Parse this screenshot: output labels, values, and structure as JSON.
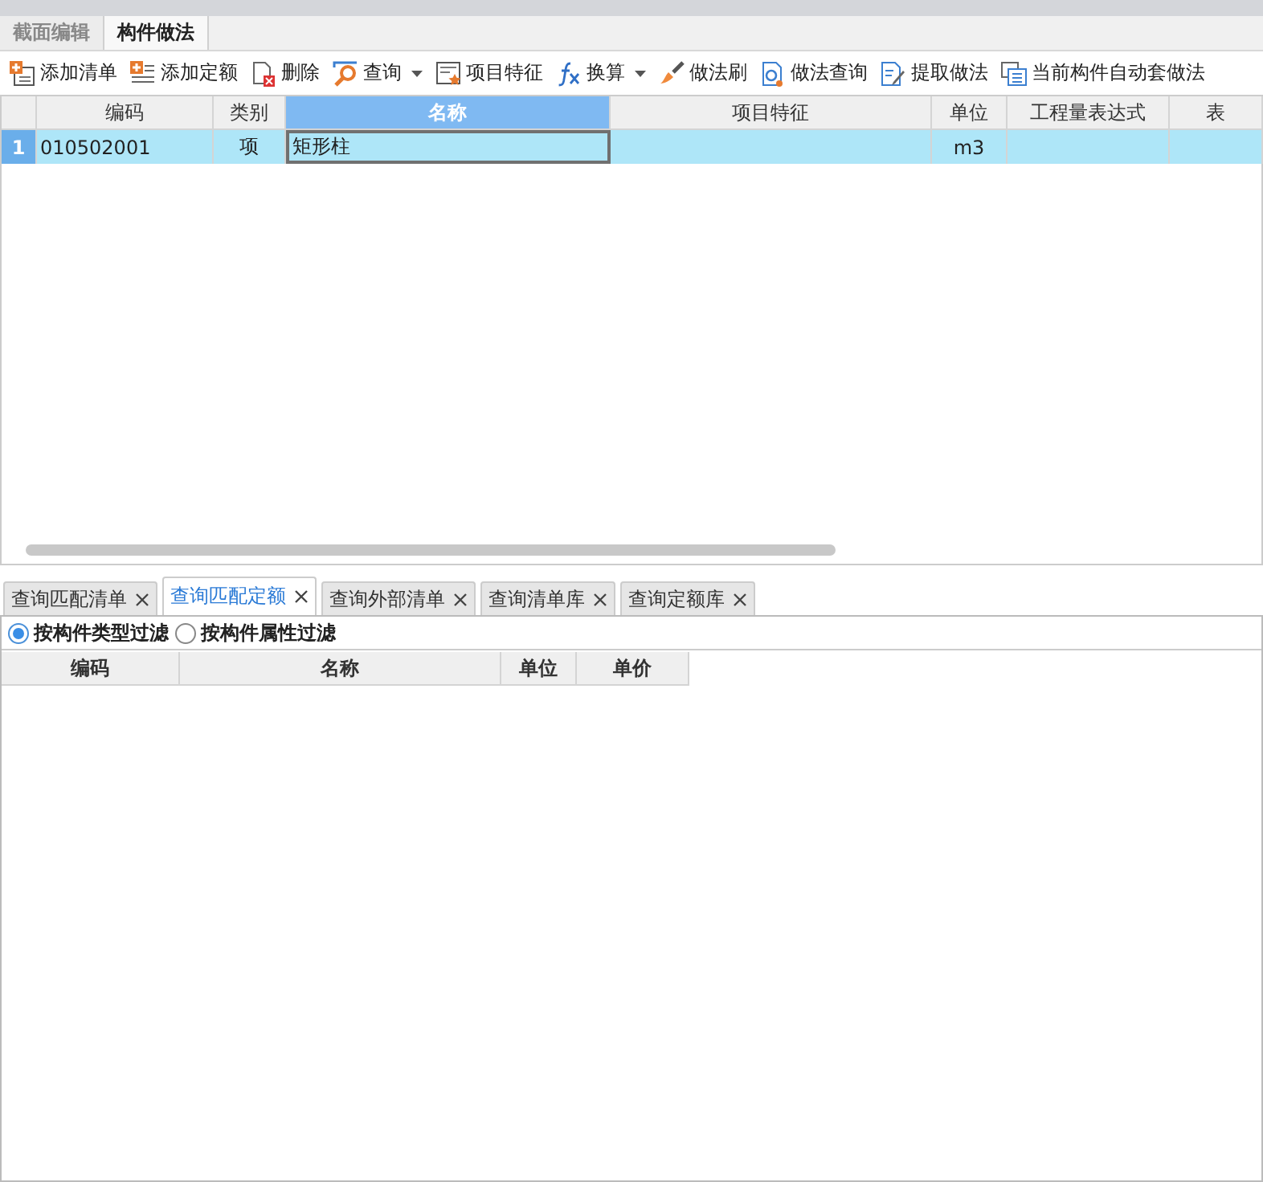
{
  "top_tabs": [
    {
      "label": "截面编辑",
      "selected": false
    },
    {
      "label": "构件做法",
      "selected": true
    }
  ],
  "toolbar": [
    {
      "label": "添加清单",
      "kind": "add-list",
      "has_menu": false
    },
    {
      "label": "添加定额",
      "kind": "add-quota",
      "has_menu": false
    },
    {
      "label": "删除",
      "kind": "delete",
      "has_menu": false
    },
    {
      "label": "查询",
      "kind": "search",
      "has_menu": true
    },
    {
      "label": "项目特征",
      "kind": "feature",
      "has_menu": false
    },
    {
      "label": "换算",
      "kind": "fx",
      "has_menu": true
    },
    {
      "label": "做法刷",
      "kind": "brush",
      "has_menu": false
    },
    {
      "label": "做法查询",
      "kind": "doc-search",
      "has_menu": false
    },
    {
      "label": "提取做法",
      "kind": "extract",
      "has_menu": false
    },
    {
      "label": "当前构件自动套做法",
      "kind": "auto",
      "has_menu": false
    }
  ],
  "table": {
    "columns": [
      {
        "label": "编码",
        "selected": false
      },
      {
        "label": "类别",
        "selected": false
      },
      {
        "label": "名称",
        "selected": true
      },
      {
        "label": "项目特征",
        "selected": false
      },
      {
        "label": "单位",
        "selected": false
      },
      {
        "label": "工程量表达式",
        "selected": false
      },
      {
        "label": "表",
        "selected": false
      }
    ],
    "rows": [
      {
        "number": "1",
        "cells": [
          "010502001",
          "项",
          "矩形柱",
          "",
          "m3",
          "",
          ""
        ],
        "selected": true
      }
    ]
  },
  "bottom_tabs": [
    {
      "label": "查询匹配清单",
      "selected": false
    },
    {
      "label": "查询匹配定额",
      "selected": true
    },
    {
      "label": "查询外部清单",
      "selected": false
    },
    {
      "label": "查询清单库",
      "selected": false
    },
    {
      "label": "查询定额库",
      "selected": false
    }
  ],
  "filters": [
    {
      "label": "按构件类型过滤",
      "selected": true
    },
    {
      "label": "按构件属性过滤",
      "selected": false
    }
  ],
  "lower_table": {
    "columns": [
      "编码",
      "名称",
      "单位",
      "单价"
    ]
  }
}
